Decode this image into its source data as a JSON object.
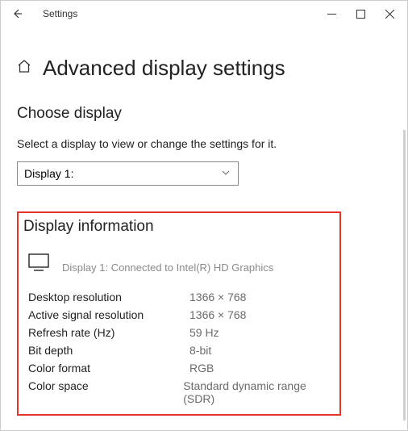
{
  "titlebar": {
    "title": "Settings"
  },
  "header": {
    "page_title": "Advanced display settings"
  },
  "choose": {
    "title": "Choose display",
    "desc": "Select a display to view or change the settings for it.",
    "selected": "Display 1:"
  },
  "info": {
    "title": "Display information",
    "connected": "Display 1: Connected to Intel(R) HD Graphics",
    "rows": [
      {
        "label": "Desktop resolution",
        "value": "1366 × 768"
      },
      {
        "label": "Active signal resolution",
        "value": "1366 × 768"
      },
      {
        "label": "Refresh rate (Hz)",
        "value": "59 Hz"
      },
      {
        "label": "Bit depth",
        "value": "8-bit"
      },
      {
        "label": "Color format",
        "value": "RGB"
      },
      {
        "label": "Color space",
        "value": "Standard dynamic range (SDR)"
      }
    ]
  }
}
